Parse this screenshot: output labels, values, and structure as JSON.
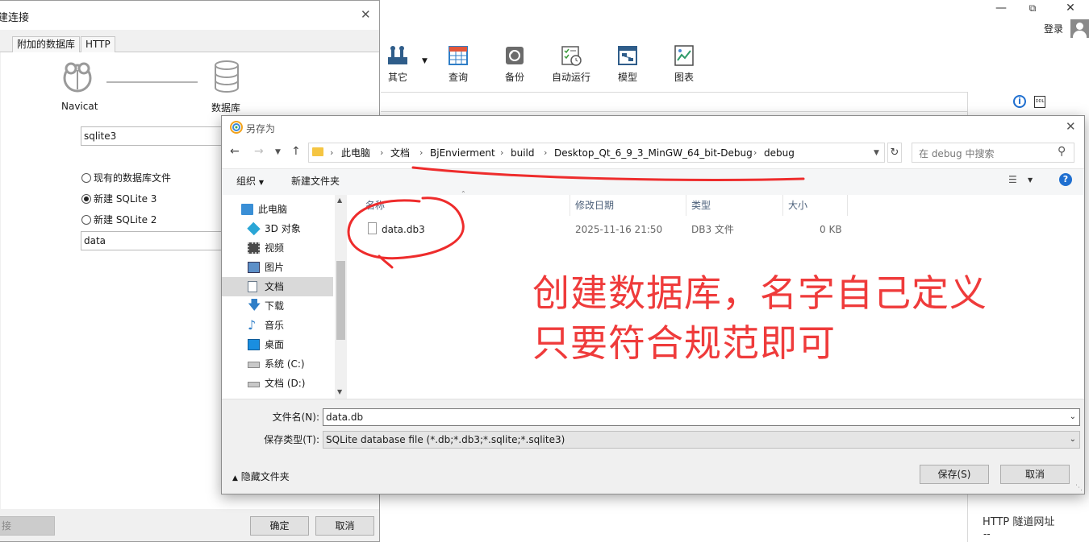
{
  "main": {
    "login_label": "登录",
    "toolbar": [
      {
        "label": "其它",
        "icon": "tools-icon"
      },
      {
        "label": "查询",
        "icon": "query-icon"
      },
      {
        "label": "备份",
        "icon": "backup-icon"
      },
      {
        "label": "自动运行",
        "icon": "schedule-icon"
      },
      {
        "label": "模型",
        "icon": "model-icon"
      },
      {
        "label": "图表",
        "icon": "chart-icon"
      }
    ],
    "right_panel": {
      "dash_1": "--",
      "http_tunnel_label": "HTTP 隧道网址",
      "dash_2": "--"
    }
  },
  "conn_dialog": {
    "title": "建连接",
    "tabs": [
      "附加的数据库",
      "HTTP"
    ],
    "navicat_label": "Navicat",
    "database_label": "数据库",
    "conn_name_value": "sqlite3",
    "radio_options": [
      {
        "label": "现有的数据库文件",
        "checked": false
      },
      {
        "label": "新建 SQLite 3",
        "checked": true
      },
      {
        "label": "新建 SQLite 2",
        "checked": false
      }
    ],
    "db_file_value": "data",
    "test_button": "接",
    "ok_button": "确定",
    "cancel_button": "取消"
  },
  "save_dialog": {
    "title": "另存为",
    "breadcrumbs": [
      "此电脑",
      "文档",
      "BjEnvierment",
      "build",
      "Desktop_Qt_6_9_3_MinGW_64_bit-Debug",
      "debug"
    ],
    "search_placeholder": "在 debug 中搜索",
    "organize_label": "组织",
    "new_folder_label": "新建文件夹",
    "nav_items": [
      {
        "label": "此电脑",
        "icon": "computer-icon"
      },
      {
        "label": "3D 对象",
        "icon": "3d-objects-icon"
      },
      {
        "label": "视频",
        "icon": "video-icon"
      },
      {
        "label": "图片",
        "icon": "pictures-icon"
      },
      {
        "label": "文档",
        "icon": "documents-icon"
      },
      {
        "label": "下载",
        "icon": "download-icon"
      },
      {
        "label": "音乐",
        "icon": "music-icon"
      },
      {
        "label": "桌面",
        "icon": "desktop-icon"
      },
      {
        "label": "系统 (C:)",
        "icon": "drive-icon"
      },
      {
        "label": "文档 (D:)",
        "icon": "drive-icon"
      }
    ],
    "columns": [
      "名称",
      "修改日期",
      "类型",
      "大小"
    ],
    "files": [
      {
        "name": "data.db3",
        "modified": "2025-11-16 21:50",
        "type": "DB3 文件",
        "size": "0 KB"
      }
    ],
    "filename_label": "文件名(N):",
    "filename_value": "data.db",
    "filetype_label": "保存类型(T):",
    "filetype_value": "SQLite database file (*.db;*.db3;*.sqlite;*.sqlite3)",
    "hide_folders_label": "隐藏文件夹",
    "save_button": "保存(S)",
    "cancel_button": "取消"
  },
  "annotation": {
    "line1": "创建数据库，名字自己定义",
    "line2": "只要符合规范即可",
    "color": "#ef3b3b"
  }
}
